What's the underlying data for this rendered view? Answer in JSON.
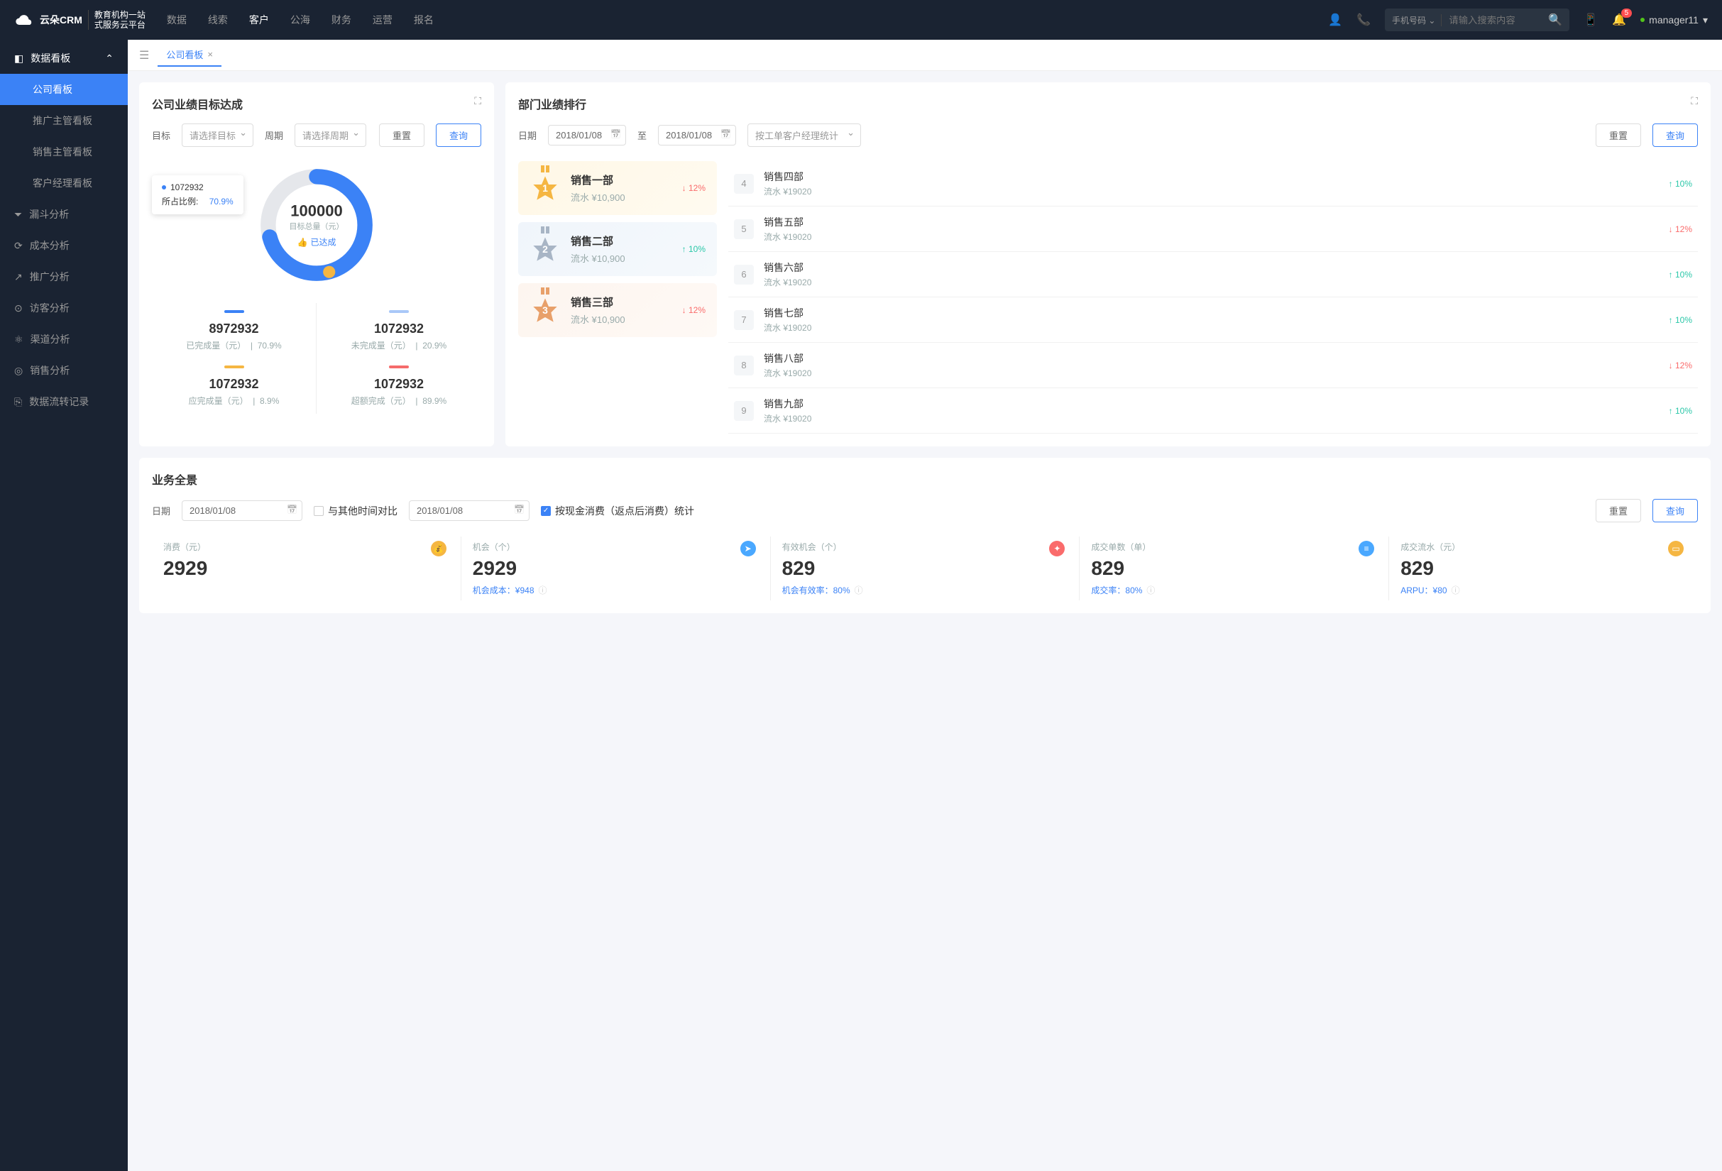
{
  "brand": {
    "name": "云朵CRM",
    "tagline1": "教育机构一站",
    "tagline2": "式服务云平台"
  },
  "nav": [
    "数据",
    "线索",
    "客户",
    "公海",
    "财务",
    "运营",
    "报名"
  ],
  "navActive": 2,
  "search": {
    "type": "手机号码",
    "placeholder": "请输入搜索内容"
  },
  "notif": {
    "count": "5"
  },
  "user": {
    "name": "manager11"
  },
  "sidebar": {
    "header": "数据看板",
    "subs": [
      "公司看板",
      "推广主管看板",
      "销售主管看板",
      "客户经理看板"
    ],
    "subActive": 0,
    "items": [
      "漏斗分析",
      "成本分析",
      "推广分析",
      "访客分析",
      "渠道分析",
      "销售分析",
      "数据流转记录"
    ]
  },
  "tabs": [
    {
      "label": "公司看板",
      "closable": true
    }
  ],
  "targetCard": {
    "title": "公司业绩目标达成",
    "filters": {
      "targetLbl": "目标",
      "targetPh": "请选择目标",
      "periodLbl": "周期",
      "periodPh": "请选择周期",
      "reset": "重置",
      "query": "查询"
    },
    "donut": {
      "total": "100000",
      "totalLbl": "目标总量（元）",
      "status": "已达成"
    },
    "tooltip": {
      "value": "1072932",
      "ratioLbl": "所占比例:",
      "ratio": "70.9%"
    },
    "stats": [
      {
        "color": "#3b82f6",
        "val": "8972932",
        "lbl": "已完成量（元）",
        "pct": "70.9%"
      },
      {
        "color": "#a9c8f8",
        "val": "1072932",
        "lbl": "未完成量（元）",
        "pct": "20.9%"
      },
      {
        "color": "#f5b642",
        "val": "1072932",
        "lbl": "应完成量（元）",
        "pct": "8.9%"
      },
      {
        "color": "#f56b6b",
        "val": "1072932",
        "lbl": "超额完成（元）",
        "pct": "89.9%"
      }
    ]
  },
  "rankCard": {
    "title": "部门业绩排行",
    "filters": {
      "dateLbl": "日期",
      "date1": "2018/01/08",
      "to": "至",
      "date2": "2018/01/08",
      "statPh": "按工单客户经理统计",
      "reset": "重置",
      "query": "查询"
    },
    "top3": [
      {
        "rank": "1",
        "name": "销售一部",
        "rev": "流水 ¥10,900",
        "pct": "12%",
        "dir": "down",
        "color": "#f5b642"
      },
      {
        "rank": "2",
        "name": "销售二部",
        "rev": "流水 ¥10,900",
        "pct": "10%",
        "dir": "up",
        "color": "#a8b5c5"
      },
      {
        "rank": "3",
        "name": "销售三部",
        "rev": "流水 ¥10,900",
        "pct": "12%",
        "dir": "down",
        "color": "#e8a06a"
      }
    ],
    "rest": [
      {
        "rank": "4",
        "name": "销售四部",
        "rev": "流水 ¥19020",
        "pct": "10%",
        "dir": "up"
      },
      {
        "rank": "5",
        "name": "销售五部",
        "rev": "流水 ¥19020",
        "pct": "12%",
        "dir": "down"
      },
      {
        "rank": "6",
        "name": "销售六部",
        "rev": "流水 ¥19020",
        "pct": "10%",
        "dir": "up"
      },
      {
        "rank": "7",
        "name": "销售七部",
        "rev": "流水 ¥19020",
        "pct": "10%",
        "dir": "up"
      },
      {
        "rank": "8",
        "name": "销售八部",
        "rev": "流水 ¥19020",
        "pct": "12%",
        "dir": "down"
      },
      {
        "rank": "9",
        "name": "销售九部",
        "rev": "流水 ¥19020",
        "pct": "10%",
        "dir": "up"
      }
    ]
  },
  "overview": {
    "title": "业务全景",
    "filters": {
      "dateLbl": "日期",
      "date1": "2018/01/08",
      "compareLbl": "与其他时间对比",
      "date2": "2018/01/08",
      "checkLbl": "按现金消费（返点后消费）统计",
      "reset": "重置",
      "query": "查询"
    },
    "stats": [
      {
        "lbl": "消费（元）",
        "val": "2929",
        "icon": "💰",
        "iconBg": "#f5b642",
        "sub": ""
      },
      {
        "lbl": "机会（个）",
        "val": "2929",
        "icon": "➤",
        "iconBg": "#4aa8ff",
        "subLbl": "机会成本：",
        "subVal": "¥948"
      },
      {
        "lbl": "有效机会（个）",
        "val": "829",
        "icon": "✦",
        "iconBg": "#fa6b6b",
        "subLbl": "机会有效率：",
        "subVal": "80%"
      },
      {
        "lbl": "成交单数（单）",
        "val": "829",
        "icon": "≡",
        "iconBg": "#4aa8ff",
        "subLbl": "成交率：",
        "subVal": "80%"
      },
      {
        "lbl": "成交流水（元）",
        "val": "829",
        "icon": "▭",
        "iconBg": "#f5b642",
        "subLbl": "ARPU：",
        "subVal": "¥80"
      }
    ]
  },
  "chart_data": {
    "type": "pie",
    "title": "公司业绩目标达成",
    "total": 100000,
    "series": [
      {
        "name": "已完成量（元）",
        "value": 8972932,
        "pct": 70.9,
        "color": "#3b82f6"
      },
      {
        "name": "未完成量（元）",
        "value": 1072932,
        "pct": 20.9,
        "color": "#a9c8f8"
      },
      {
        "name": "应完成量（元）",
        "value": 1072932,
        "pct": 8.9,
        "color": "#f5b642"
      },
      {
        "name": "超额完成（元）",
        "value": 1072932,
        "pct": 89.9,
        "color": "#f56b6b"
      }
    ]
  }
}
